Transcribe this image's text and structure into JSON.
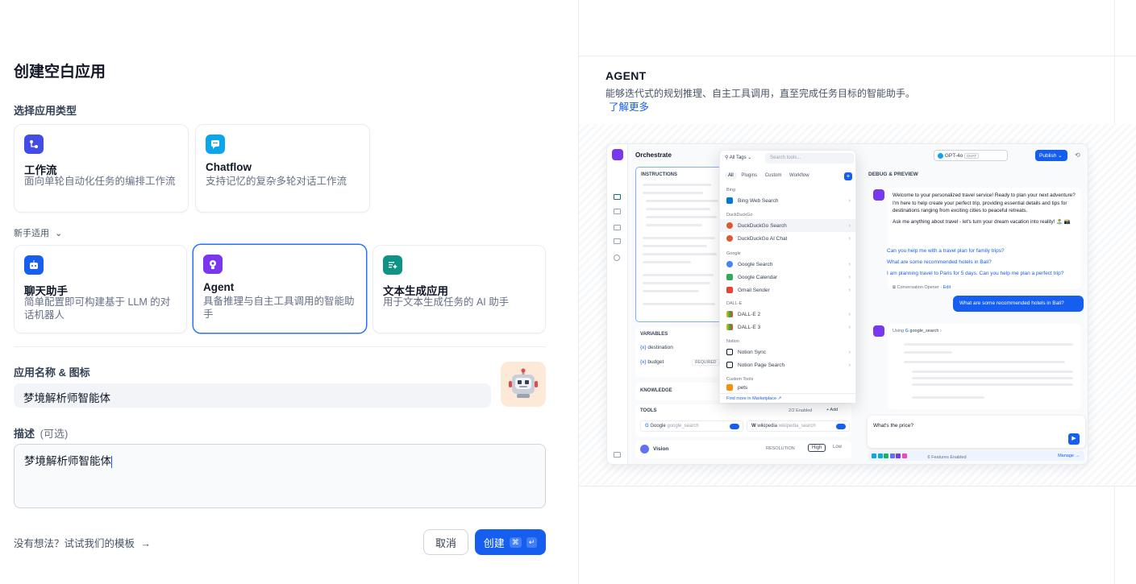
{
  "left": {
    "title": "创建空白应用",
    "type_label": "选择应用类型",
    "cards_top": [
      {
        "title": "工作流",
        "desc": "面向单轮自动化任务的编排工作流",
        "icon": "workflow-icon",
        "color": "#444ce7"
      },
      {
        "title": "Chatflow",
        "desc": "支持记忆的复杂多轮对话工作流",
        "icon": "chatflow-icon",
        "color": "#0ba5ec"
      }
    ],
    "newbie_label": "新手适用",
    "cards_bottom": [
      {
        "title": "聊天助手",
        "desc": "简单配置即可构建基于 LLM 的对话机器人",
        "icon": "chat-assistant-icon",
        "color": "#155eef"
      },
      {
        "title": "Agent",
        "desc": "具备推理与自主工具调用的智能助手",
        "icon": "agent-icon",
        "color": "#7839ee"
      },
      {
        "title": "文本生成应用",
        "desc": "用于文本生成任务的 AI 助手",
        "icon": "text-generation-icon",
        "color": "#0e9384"
      }
    ],
    "name_label": "应用名称 & 图标",
    "name_value": "梦境解析师智能体",
    "desc_label": "描述",
    "desc_optional": "(可选)",
    "desc_value": "梦境解析师智能体",
    "template_link": "没有想法？试试我们的模板",
    "cancel": "取消",
    "create": "创建",
    "create_kbd_1": "⌘",
    "create_kbd_2": "↵"
  },
  "right": {
    "title": "AGENT",
    "desc": "能够迭代式的规划推理、自主工具调用，直至完成任务目标的智能助手。",
    "link": "了解更多",
    "preview": {
      "header": "Orchestrate",
      "instructions": "INSTRUCTIONS",
      "variables": "VARIABLES",
      "var1": "destination",
      "var2": "budget",
      "var2_badge": "REQUIRED",
      "knowledge": "KNOWLEDGE",
      "tools": "TOOLS",
      "tools_enabled": "2/2 Enabled",
      "tools_add": "+ Add",
      "tool1_name": "Google",
      "tool1_id": "google_search",
      "tool2_name": "wikipedia",
      "tool2_id": "wikipedia_search",
      "vision": "Vision",
      "resolution": "RESOLUTION",
      "high": "High",
      "low": "Low",
      "model": "GPT-4o",
      "model_badge": "CHAT",
      "publish": "Publish",
      "dropdown": {
        "all_tags": "All Tags",
        "search_placeholder": "Search tools...",
        "tabs": [
          "All",
          "Plugins",
          "Custom",
          "Workflow"
        ],
        "groups": [
          {
            "name": "Bing",
            "items": [
              "Bing Web Search"
            ]
          },
          {
            "name": "DuckDuckGo",
            "items": [
              "DuckDuckGo Search",
              "DuckDuckGo AI Chat"
            ]
          },
          {
            "name": "Google",
            "items": [
              "Google Search",
              "Google Calendar",
              "Gmail Sender"
            ]
          },
          {
            "name": "DALL-E",
            "items": [
              "DALL-E 2",
              "DALL-E 3"
            ]
          },
          {
            "name": "Notion",
            "items": [
              "Notion Sync",
              "Notion Page Search"
            ]
          },
          {
            "name": "Custom Tools",
            "items": [
              "pets"
            ]
          }
        ],
        "marketplace": "Find more in Marketplace ↗"
      },
      "debug": {
        "title": "DEBUG & PREVIEW",
        "welcome": "Welcome to your personalized travel service! Ready to plan your next adventure? I'm here to help create your perfect trip, providing essential details and tips for destinations ranging from exciting cities to peaceful retreats.",
        "ask": "Ask me anything about travel - let's turn your dream vacation into reality! 🏝️ 📸",
        "q1": "Can you help me with a travel plan for family trips?",
        "q2": "What are some recommended hotels in Bali?",
        "q3": "I am planning travel to Paris for 5 days. Can you help me plan a perfect trip?",
        "opener": "Conversation Opener",
        "edit": "Edit",
        "user_msg": "What are some recommended hotels in Bali?",
        "using": "Using",
        "using_tool": "google_search",
        "input": "What's the price?",
        "features": "6 Features Enabled",
        "manage": "Manage →"
      }
    }
  }
}
